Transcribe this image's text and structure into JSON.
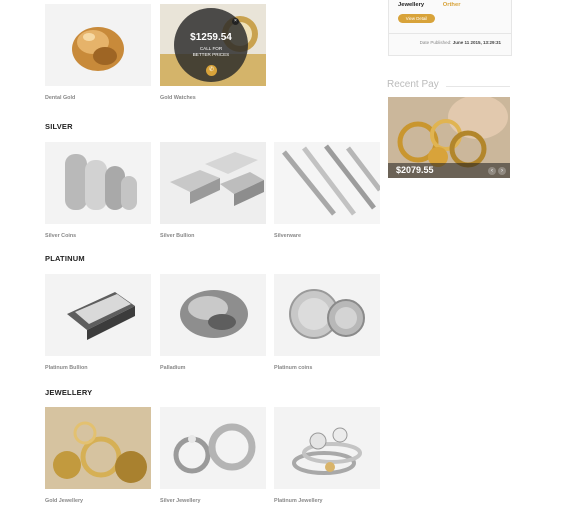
{
  "gold_row": {
    "items": [
      {
        "label": "Dental Gold"
      },
      {
        "label": "Gold Watches"
      }
    ],
    "price_overlay": {
      "amount": "$1259.54",
      "line1": "CALL FOR",
      "line2": "BETTER PRICES",
      "close_glyph": "×",
      "phone_glyph": "✆"
    }
  },
  "silver": {
    "title": "SILVER",
    "items": [
      {
        "label": "Silver Coins"
      },
      {
        "label": "Silver Bullion"
      },
      {
        "label": "Silverware"
      }
    ]
  },
  "platinum": {
    "title": "PLATINUM",
    "items": [
      {
        "label": "Platinum Bullion"
      },
      {
        "label": "Palladium"
      },
      {
        "label": "Platinum coins"
      }
    ]
  },
  "jewellery": {
    "title": "JEWELLERY",
    "items": [
      {
        "label": "Gold Jewellery"
      },
      {
        "label": "Silver Jewellery"
      },
      {
        "label": "Platinum Jewellery"
      }
    ]
  },
  "sidebar": {
    "tag1": "Jewellery",
    "tag2": "Orther",
    "view_button": "View Detail",
    "date_label": "Date Published:",
    "date_value": "June 11 2015, 13:29:31",
    "recent_title": "Recent Pay",
    "recent_price": "$2079.55",
    "prev_glyph": "‹",
    "next_glyph": "›"
  },
  "colors": {
    "accent": "#d8a33a"
  }
}
